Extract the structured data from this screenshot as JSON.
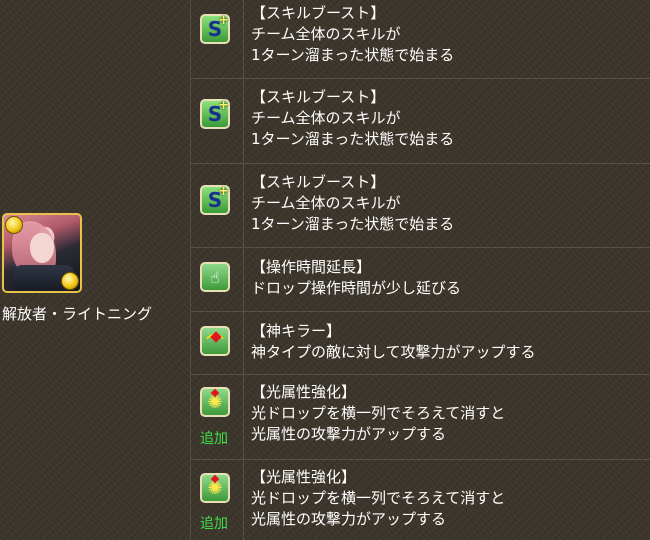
{
  "character": {
    "name": "解放者・ライトニング",
    "portrait_icon": "character-portrait",
    "orb_color": "#f2c516"
  },
  "awakenings": [
    {
      "icon": "skill-boost-icon",
      "title": "【スキルブースト】",
      "lines": [
        "チーム全体のスキルが",
        "1ターン溜まった状態で始まる"
      ],
      "added": ""
    },
    {
      "icon": "skill-boost-icon",
      "title": "【スキルブースト】",
      "lines": [
        "チーム全体のスキルが",
        "1ターン溜まった状態で始まる"
      ],
      "added": ""
    },
    {
      "icon": "skill-boost-icon",
      "title": "【スキルブースト】",
      "lines": [
        "チーム全体のスキルが",
        "1ターン溜まった状態で始まる"
      ],
      "added": ""
    },
    {
      "icon": "extend-time-icon",
      "title": "【操作時間延長】",
      "lines": [
        "ドロップ操作時間が少し延びる"
      ],
      "added": ""
    },
    {
      "icon": "god-killer-icon",
      "title": "【神キラー】",
      "lines": [
        "神タイプの敵に対して攻撃力がアップする"
      ],
      "added": ""
    },
    {
      "icon": "light-row-icon",
      "title": "【光属性強化】",
      "lines": [
        "光ドロップを横一列でそろえて消すと",
        "光属性の攻撃力がアップする"
      ],
      "added": "追加"
    },
    {
      "icon": "light-row-icon",
      "title": "【光属性強化】",
      "lines": [
        "光ドロップを横一列でそろえて消すと",
        "光属性の攻撃力がアップする"
      ],
      "added": "追加"
    }
  ],
  "colors": {
    "background": "#3b342b",
    "text": "#ffffff",
    "added_label": "#3fe04a",
    "icon_green": "#3f9a3b"
  }
}
